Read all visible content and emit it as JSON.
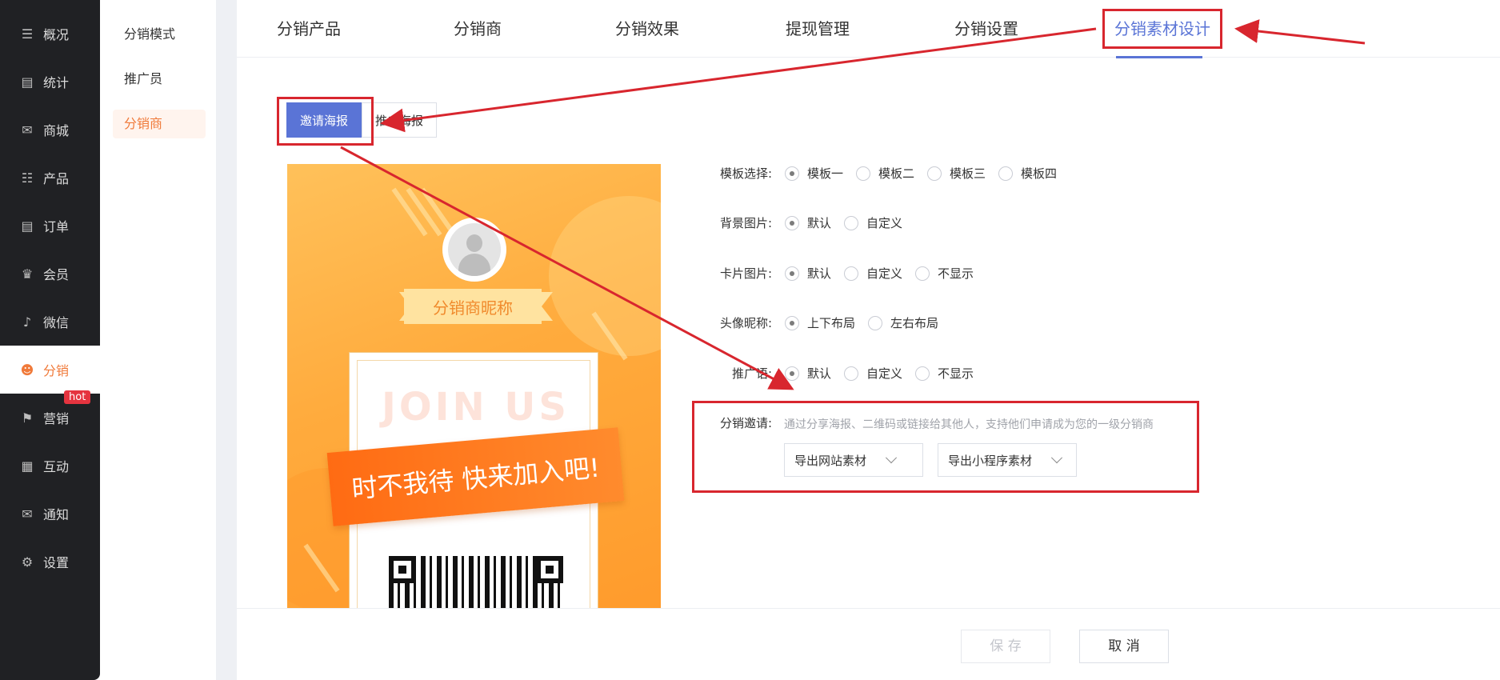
{
  "sidebar": {
    "items": [
      {
        "label": "概况",
        "icon": "layers-icon"
      },
      {
        "label": "统计",
        "icon": "chart-icon"
      },
      {
        "label": "商城",
        "icon": "mail-icon"
      },
      {
        "label": "产品",
        "icon": "grid-icon"
      },
      {
        "label": "订单",
        "icon": "clipboard-icon"
      },
      {
        "label": "会员",
        "icon": "crown-icon"
      },
      {
        "label": "微信",
        "icon": "tiktok-icon"
      },
      {
        "label": "分销",
        "icon": "user-group-icon"
      },
      {
        "label": "营销",
        "icon": "flag-icon"
      },
      {
        "label": "互动",
        "icon": "blocks-icon"
      },
      {
        "label": "通知",
        "icon": "envelope-icon"
      },
      {
        "label": "设置",
        "icon": "gear-icon"
      }
    ],
    "hot_badge": "hot"
  },
  "submenu": {
    "items": [
      "分销模式",
      "推广员",
      "分销商"
    ]
  },
  "tabs": [
    "分销产品",
    "分销商",
    "分销效果",
    "提现管理",
    "分销设置",
    "分销素材设计"
  ],
  "poster_tabs": [
    "邀请海报",
    "推广海报"
  ],
  "poster": {
    "nickname": "分销商昵称",
    "join_text": "JOIN US",
    "slogan": "时不我待 快来加入吧!"
  },
  "form": {
    "template": {
      "label": "模板选择:",
      "options": [
        "模板一",
        "模板二",
        "模板三",
        "模板四"
      ]
    },
    "background": {
      "label": "背景图片:",
      "options": [
        "默认",
        "自定义"
      ]
    },
    "card": {
      "label": "卡片图片:",
      "options": [
        "默认",
        "自定义",
        "不显示"
      ]
    },
    "avatar": {
      "label": "头像昵称:",
      "options": [
        "上下布局",
        "左右布局"
      ]
    },
    "promo": {
      "label": "推广语:",
      "options": [
        "默认",
        "自定义",
        "不显示"
      ]
    },
    "invite": {
      "label": "分销邀请:",
      "hint": "通过分享海报、二维码或链接给其他人，支持他们申请成为您的一级分销商",
      "export_site": "导出网站素材",
      "export_mini": "导出小程序素材"
    }
  },
  "footer": {
    "save": "保 存",
    "cancel": "取 消"
  },
  "colors": {
    "accent": "#5a74d6",
    "brand": "#f07a3a",
    "annotation": "#d8262e"
  }
}
